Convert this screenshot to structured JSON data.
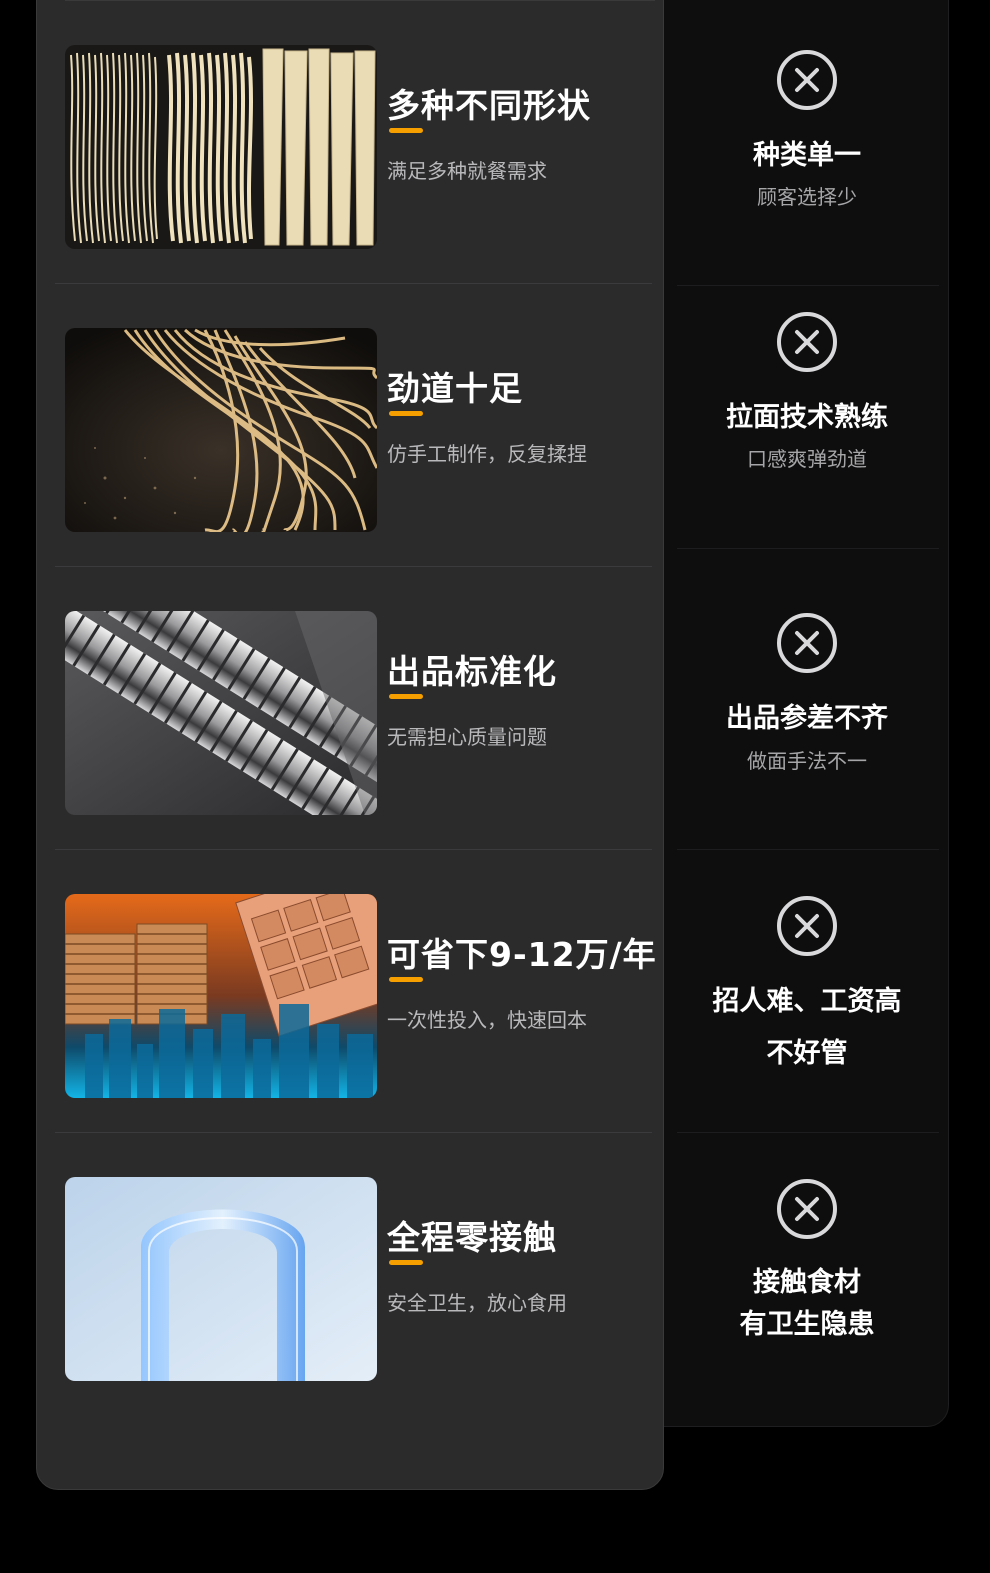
{
  "features": [
    {
      "title": "多种不同形状",
      "desc": "满足多种就餐需求",
      "image": "noodle-shapes-image"
    },
    {
      "title": "劲道十足",
      "desc": "仿手工制作，反复揉捏",
      "image": "tossed-noodles-image"
    },
    {
      "title": "出品标准化",
      "desc": "无需担心质量问题",
      "image": "steel-rollers-image"
    },
    {
      "title": "可省下9-12万/年",
      "desc": "一次性投入，快速回本",
      "image": "coins-calculator-image"
    },
    {
      "title": "全程零接触",
      "desc": "安全卫生，放心食用",
      "image": "glass-u-shape-image"
    }
  ],
  "drawbacks": [
    {
      "title": "种类单一",
      "sub": "顾客选择少"
    },
    {
      "title": "拉面技术熟练",
      "sub": "口感爽弹劲道"
    },
    {
      "title": "出品参差不齐",
      "sub": "做面手法不一"
    },
    {
      "title_line1": "招人难、工资高",
      "title_line2": "不好管"
    },
    {
      "title_line1": "接触食材",
      "title_line2": "有卫生隐患"
    }
  ],
  "colors": {
    "accent": "#f5a000",
    "left_bg": "#2b2b2c",
    "right_bg": "#0e0e0f"
  }
}
